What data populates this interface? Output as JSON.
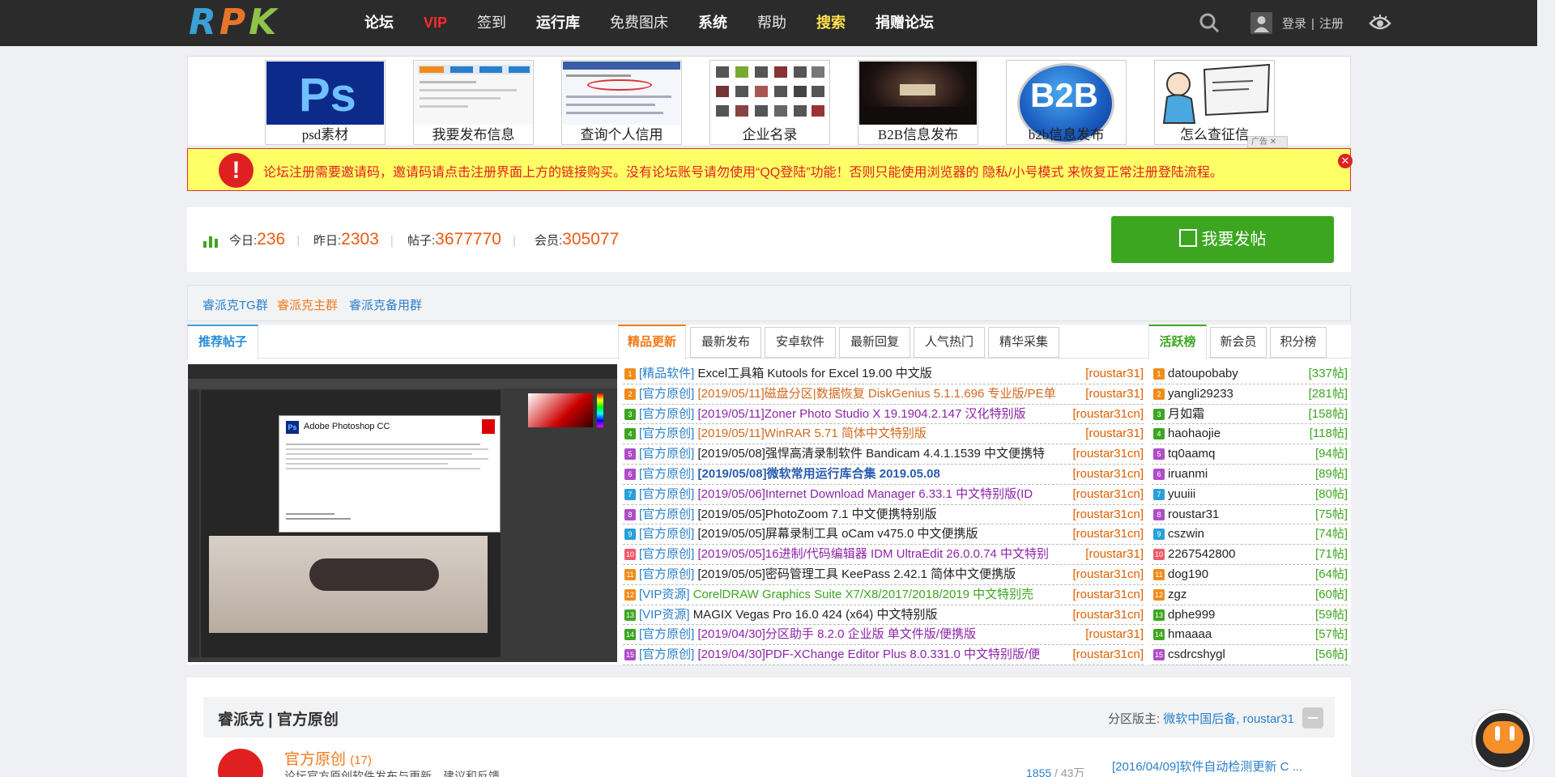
{
  "app": {
    "logo_text_1": "R",
    "logo_text_2": "P",
    "logo_text_3": "K"
  },
  "nav": {
    "items": [
      "论坛",
      "VIP",
      "签到",
      "运行库",
      "免费图床",
      "系统",
      "帮助",
      "搜索",
      "捐赠论坛"
    ],
    "login": "登录",
    "separator": "|",
    "register": "注册"
  },
  "ads": [
    {
      "caption": "psd素材",
      "icon": "photoshop-logo"
    },
    {
      "caption": "我要发布信息",
      "icon": "web-screenshot"
    },
    {
      "caption": "查询个人信用",
      "icon": "form-screenshot"
    },
    {
      "caption": "企业名录",
      "icon": "product-grid"
    },
    {
      "caption": "B2B信息发布",
      "icon": "stage-photo"
    },
    {
      "caption": "b2b信息发布",
      "icon": "b2b-logo"
    },
    {
      "caption": "怎么查征信",
      "icon": "cartoon-laptop"
    }
  ],
  "ad_tag": "广告",
  "notice": {
    "text": "论坛注册需要邀请码，邀请码请点击注册界面上方的链接购买。没有论坛账号请勿使用“QQ登陆”功能！否则只能使用浏览器的 隐私/小号模式 来恢复正常注册登陆流程。"
  },
  "stats": {
    "today_label": "今日:",
    "today": "236",
    "yesterday_label": "昨日:",
    "yesterday": "2303",
    "posts_label": "帖子:",
    "posts": "3677770",
    "members_label": "会员:",
    "members": "305077",
    "post_button": "我要发帖"
  },
  "groups": [
    "睿派克TG群",
    "睿派克主群",
    "睿派克备用群"
  ],
  "left_panel": {
    "tab": "推荐帖子",
    "dialog_title": "Adobe Photoshop CC"
  },
  "mid_panel": {
    "tabs": [
      "精品更新",
      "最新发布",
      "安卓软件",
      "最新回复",
      "人气热门",
      "精华采集"
    ],
    "rows": [
      {
        "tag": "[精品软件]",
        "title": "Excel工具箱 Kutools for Excel 19.00 中文版",
        "author": "[roustar31]",
        "color": "#222222",
        "bold": false
      },
      {
        "tag": "[官方原创]",
        "title": "[2019/05/11]磁盘分区|数据恢复 DiskGenius 5.1.1.696 专业版/PE单",
        "author": "[roustar31]",
        "color": "#d2691e",
        "bold": false
      },
      {
        "tag": "[官方原创]",
        "title": "[2019/05/11]Zoner Photo Studio X 19.1904.2.147 汉化特别版",
        "author": "[roustar31cn]",
        "color": "#8e24aa",
        "bold": false
      },
      {
        "tag": "[官方原创]",
        "title": "[2019/05/11]WinRAR 5.71 简体中文特别版",
        "author": "[roustar31]",
        "color": "#d2691e",
        "bold": false
      },
      {
        "tag": "[官方原创]",
        "title": "[2019/05/08]强悍高清录制软件 Bandicam 4.4.1.1539 中文便携特",
        "author": "[roustar31cn]",
        "color": "#222222",
        "bold": false
      },
      {
        "tag": "[官方原创]",
        "title": "[2019/05/08]微软常用运行库合集 2019.05.08",
        "author": "[roustar31cn]",
        "color": "#2a5db0",
        "bold": true
      },
      {
        "tag": "[官方原创]",
        "title": "[2019/05/06]Internet Download Manager 6.33.1 中文特别版(ID",
        "author": "[roustar31cn]",
        "color": "#8e24aa",
        "bold": false
      },
      {
        "tag": "[官方原创]",
        "title": "[2019/05/05]PhotoZoom 7.1 中文便携特别版",
        "author": "[roustar31cn]",
        "color": "#222222",
        "bold": false
      },
      {
        "tag": "[官方原创]",
        "title": "[2019/05/05]屏幕录制工具 oCam v475.0 中文便携版",
        "author": "[roustar31cn]",
        "color": "#222222",
        "bold": false
      },
      {
        "tag": "[官方原创]",
        "title": "[2019/05/05]16进制/代码编辑器 IDM UltraEdit 26.0.0.74 中文特别",
        "author": "[roustar31]",
        "color": "#8e24aa",
        "bold": false
      },
      {
        "tag": "[官方原创]",
        "title": "[2019/05/05]密码管理工具 KeePass 2.42.1 简体中文便携版",
        "author": "[roustar31cn]",
        "color": "#222222",
        "bold": false
      },
      {
        "tag": "[VIP资源]",
        "title": "CorelDRAW Graphics Suite X7/X8/2017/2018/2019 中文特别売",
        "author": "[roustar31cn]",
        "color": "#3da621",
        "bold": false
      },
      {
        "tag": "[VIP资源]",
        "title": "MAGIX Vegas Pro 16.0 424 (x64) 中文特别版",
        "author": "[roustar31cn]",
        "color": "#222222",
        "bold": false
      },
      {
        "tag": "[官方原创]",
        "title": "[2019/04/30]分区助手 8.2.0 企业版 单文件版/便携版",
        "author": "[roustar31]",
        "color": "#8e24aa",
        "bold": false
      },
      {
        "tag": "[官方原创]",
        "title": "[2019/04/30]PDF-XChange Editor Plus 8.0.331.0 中文特别版/便",
        "author": "[roustar31cn]",
        "color": "#8e24aa",
        "bold": false
      }
    ]
  },
  "right_panel": {
    "tabs": [
      "活跃榜",
      "新会员",
      "积分榜"
    ],
    "rows": [
      {
        "user": "datoupobaby",
        "count": "[337帖]"
      },
      {
        "user": "yangli29233",
        "count": "[281帖]"
      },
      {
        "user": "月如霜",
        "count": "[158帖]"
      },
      {
        "user": "haohaojie",
        "count": "[118帖]"
      },
      {
        "user": "tq0aamq",
        "count": "[94帖]"
      },
      {
        "user": "iruanmi",
        "count": "[89帖]"
      },
      {
        "user": "yuuiii",
        "count": "[80帖]"
      },
      {
        "user": "roustar31",
        "count": "[75帖]"
      },
      {
        "user": "cszwin",
        "count": "[74帖]"
      },
      {
        "user": "2267542800",
        "count": "[71帖]"
      },
      {
        "user": "dog190",
        "count": "[64帖]"
      },
      {
        "user": "zgz",
        "count": "[60帖]"
      },
      {
        "user": "dphe999",
        "count": "[59帖]"
      },
      {
        "user": "hmaaaa",
        "count": "[57帖]"
      },
      {
        "user": "csdrcshygl",
        "count": "[56帖]"
      }
    ]
  },
  "rank_colors": [
    "#f08c1a",
    "#f08c1a",
    "#3da621",
    "#3da621",
    "#b04cc8",
    "#b04cc8",
    "#2aa0d8",
    "#b04cc8",
    "#2aa0d8",
    "#f05a6a",
    "#f08c1a",
    "#f08c1a",
    "#3da621",
    "#3da621",
    "#b04cc8"
  ],
  "section": {
    "title": "睿派克 | 官方原创",
    "moderators_label": "分区版主:",
    "moderators": "微软中国后备, roustar31",
    "forum_name": "官方原创",
    "forum_count": "(17)",
    "forum_desc": "论坛官方原创软件发布与更新，建议和反馈",
    "forum_threads": "1855",
    "forum_posts": "/ 43万",
    "last_post": "[2016/04/09]软件自动检测更新 C ..."
  }
}
